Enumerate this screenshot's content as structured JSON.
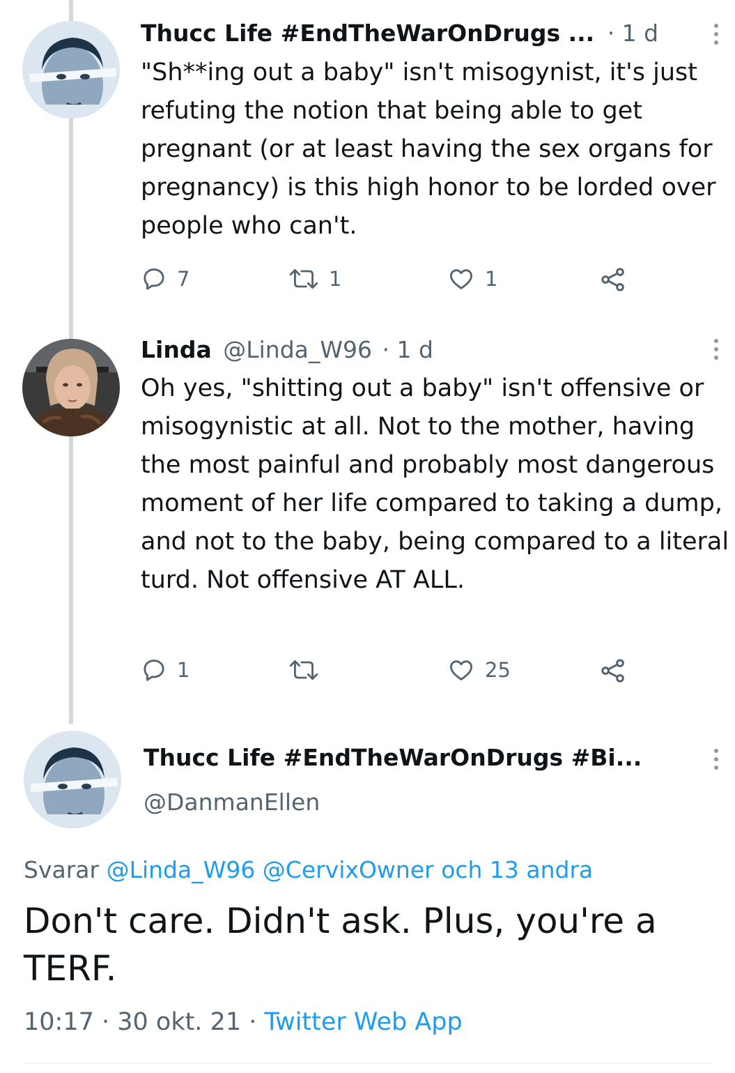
{
  "tweets": [
    {
      "author_name": "Thucc Life #EndTheWarOnDrugs ...",
      "time": "· 1 d",
      "text": "\"Sh**ing out a baby\" isn't misogynist, it's just refuting the notion that being able to get pregnant (or at least having the sex organs for pregnancy) is this high honor to be lorded over people who can't.",
      "replies": "7",
      "retweets": "1",
      "likes": "1"
    },
    {
      "author_name": "Linda",
      "author_handle": "@Linda_W96",
      "time": "· 1 d",
      "text": "Oh yes, \"shitting out a baby\" isn't offensive or misogynistic at all. Not to the mother, having the most painful and probably most dangerous moment of her life compared to taking a dump, and not to the baby, being compared to a literal turd. Not offensive AT ALL.",
      "replies": "1",
      "retweets": "",
      "likes": "25"
    }
  ],
  "main_tweet": {
    "author_name": "Thucc Life #EndTheWarOnDrugs #Bi...",
    "author_handle": "@DanmanEllen",
    "reply_prefix": "Svarar",
    "reply_targets": "@Linda_W96 @CervixOwner och 13 andra",
    "text": "Don't care. Didn't ask. Plus, you're a TERF.",
    "timestamp": "10:17 · 30 okt. 21 ·",
    "source": "Twitter Web App"
  },
  "colors": {
    "text": "#0f1419",
    "muted": "#536471",
    "link": "#1d9bf0",
    "thread_line": "#cfd9de"
  },
  "icons": [
    "reply-icon",
    "retweet-icon",
    "like-icon",
    "share-icon",
    "more-icon"
  ]
}
